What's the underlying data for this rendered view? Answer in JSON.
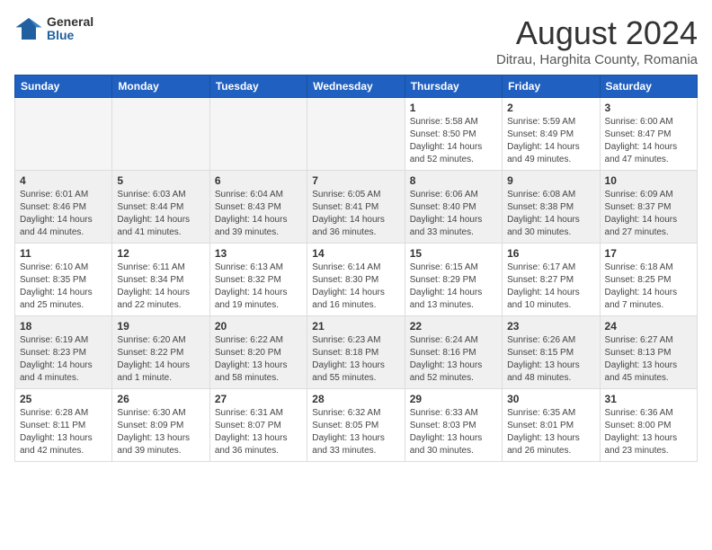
{
  "logo": {
    "general": "General",
    "blue": "Blue"
  },
  "title": {
    "month_year": "August 2024",
    "location": "Ditrau, Harghita County, Romania"
  },
  "weekdays": [
    "Sunday",
    "Monday",
    "Tuesday",
    "Wednesday",
    "Thursday",
    "Friday",
    "Saturday"
  ],
  "weeks": [
    [
      {
        "day": "",
        "info": ""
      },
      {
        "day": "",
        "info": ""
      },
      {
        "day": "",
        "info": ""
      },
      {
        "day": "",
        "info": ""
      },
      {
        "day": "1",
        "info": "Sunrise: 5:58 AM\nSunset: 8:50 PM\nDaylight: 14 hours and 52 minutes."
      },
      {
        "day": "2",
        "info": "Sunrise: 5:59 AM\nSunset: 8:49 PM\nDaylight: 14 hours and 49 minutes."
      },
      {
        "day": "3",
        "info": "Sunrise: 6:00 AM\nSunset: 8:47 PM\nDaylight: 14 hours and 47 minutes."
      }
    ],
    [
      {
        "day": "4",
        "info": "Sunrise: 6:01 AM\nSunset: 8:46 PM\nDaylight: 14 hours and 44 minutes."
      },
      {
        "day": "5",
        "info": "Sunrise: 6:03 AM\nSunset: 8:44 PM\nDaylight: 14 hours and 41 minutes."
      },
      {
        "day": "6",
        "info": "Sunrise: 6:04 AM\nSunset: 8:43 PM\nDaylight: 14 hours and 39 minutes."
      },
      {
        "day": "7",
        "info": "Sunrise: 6:05 AM\nSunset: 8:41 PM\nDaylight: 14 hours and 36 minutes."
      },
      {
        "day": "8",
        "info": "Sunrise: 6:06 AM\nSunset: 8:40 PM\nDaylight: 14 hours and 33 minutes."
      },
      {
        "day": "9",
        "info": "Sunrise: 6:08 AM\nSunset: 8:38 PM\nDaylight: 14 hours and 30 minutes."
      },
      {
        "day": "10",
        "info": "Sunrise: 6:09 AM\nSunset: 8:37 PM\nDaylight: 14 hours and 27 minutes."
      }
    ],
    [
      {
        "day": "11",
        "info": "Sunrise: 6:10 AM\nSunset: 8:35 PM\nDaylight: 14 hours and 25 minutes."
      },
      {
        "day": "12",
        "info": "Sunrise: 6:11 AM\nSunset: 8:34 PM\nDaylight: 14 hours and 22 minutes."
      },
      {
        "day": "13",
        "info": "Sunrise: 6:13 AM\nSunset: 8:32 PM\nDaylight: 14 hours and 19 minutes."
      },
      {
        "day": "14",
        "info": "Sunrise: 6:14 AM\nSunset: 8:30 PM\nDaylight: 14 hours and 16 minutes."
      },
      {
        "day": "15",
        "info": "Sunrise: 6:15 AM\nSunset: 8:29 PM\nDaylight: 14 hours and 13 minutes."
      },
      {
        "day": "16",
        "info": "Sunrise: 6:17 AM\nSunset: 8:27 PM\nDaylight: 14 hours and 10 minutes."
      },
      {
        "day": "17",
        "info": "Sunrise: 6:18 AM\nSunset: 8:25 PM\nDaylight: 14 hours and 7 minutes."
      }
    ],
    [
      {
        "day": "18",
        "info": "Sunrise: 6:19 AM\nSunset: 8:23 PM\nDaylight: 14 hours and 4 minutes."
      },
      {
        "day": "19",
        "info": "Sunrise: 6:20 AM\nSunset: 8:22 PM\nDaylight: 14 hours and 1 minute."
      },
      {
        "day": "20",
        "info": "Sunrise: 6:22 AM\nSunset: 8:20 PM\nDaylight: 13 hours and 58 minutes."
      },
      {
        "day": "21",
        "info": "Sunrise: 6:23 AM\nSunset: 8:18 PM\nDaylight: 13 hours and 55 minutes."
      },
      {
        "day": "22",
        "info": "Sunrise: 6:24 AM\nSunset: 8:16 PM\nDaylight: 13 hours and 52 minutes."
      },
      {
        "day": "23",
        "info": "Sunrise: 6:26 AM\nSunset: 8:15 PM\nDaylight: 13 hours and 48 minutes."
      },
      {
        "day": "24",
        "info": "Sunrise: 6:27 AM\nSunset: 8:13 PM\nDaylight: 13 hours and 45 minutes."
      }
    ],
    [
      {
        "day": "25",
        "info": "Sunrise: 6:28 AM\nSunset: 8:11 PM\nDaylight: 13 hours and 42 minutes."
      },
      {
        "day": "26",
        "info": "Sunrise: 6:30 AM\nSunset: 8:09 PM\nDaylight: 13 hours and 39 minutes."
      },
      {
        "day": "27",
        "info": "Sunrise: 6:31 AM\nSunset: 8:07 PM\nDaylight: 13 hours and 36 minutes."
      },
      {
        "day": "28",
        "info": "Sunrise: 6:32 AM\nSunset: 8:05 PM\nDaylight: 13 hours and 33 minutes."
      },
      {
        "day": "29",
        "info": "Sunrise: 6:33 AM\nSunset: 8:03 PM\nDaylight: 13 hours and 30 minutes."
      },
      {
        "day": "30",
        "info": "Sunrise: 6:35 AM\nSunset: 8:01 PM\nDaylight: 13 hours and 26 minutes."
      },
      {
        "day": "31",
        "info": "Sunrise: 6:36 AM\nSunset: 8:00 PM\nDaylight: 13 hours and 23 minutes."
      }
    ]
  ]
}
